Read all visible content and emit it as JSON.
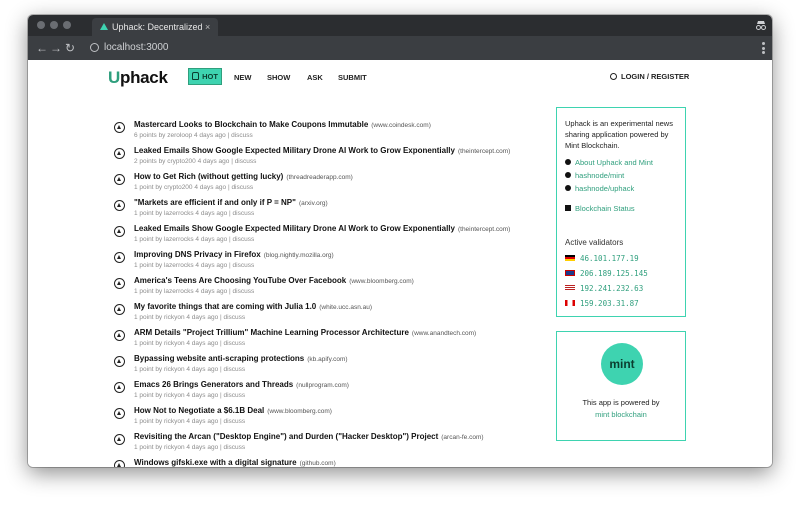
{
  "browser": {
    "tab_title": "Uphack: Decentralized Hac",
    "tab_close": "×",
    "url": "localhost:3000",
    "back": "←",
    "forward": "→",
    "reload": "↻"
  },
  "header": {
    "logo": "Uphack",
    "nav": [
      {
        "label": "HOT",
        "active": true
      },
      {
        "label": "NEW"
      },
      {
        "label": "SHOW"
      },
      {
        "label": "ASK"
      },
      {
        "label": "SUBMIT"
      }
    ],
    "login": "LOGIN / REGISTER"
  },
  "posts": [
    {
      "title": "Mastercard Looks to Blockchain to Make Coupons Immutable",
      "domain": "(www.coindesk.com)",
      "meta": "6 points  by zeroloop  4 days ago  |  discuss"
    },
    {
      "title": "Leaked Emails Show Google Expected Military Drone AI Work to Grow Exponentially",
      "domain": "(theintercept.com)",
      "meta": "2 points  by crypto200  4 days ago  |  discuss"
    },
    {
      "title": "How to Get Rich (without getting lucky)",
      "domain": "(threadreaderapp.com)",
      "meta": "1 point  by crypto200  4 days ago  |  discuss"
    },
    {
      "title": "\"Markets are efficient if and only if P = NP\"",
      "domain": "(arxiv.org)",
      "meta": "1 point  by lazerrocks  4 days ago  |  discuss"
    },
    {
      "title": "Leaked Emails Show Google Expected Military Drone AI Work to Grow Exponentially",
      "domain": "(theintercept.com)",
      "meta": "1 point  by lazerrocks  4 days ago  |  discuss"
    },
    {
      "title": "Improving DNS Privacy in Firefox",
      "domain": "(blog.nightly.mozilla.org)",
      "meta": "1 point  by lazerrocks  4 days ago  |  discuss"
    },
    {
      "title": "America's Teens Are Choosing YouTube Over Facebook",
      "domain": "(www.bloomberg.com)",
      "meta": "1 point  by lazerrocks  4 days ago  |  discuss"
    },
    {
      "title": "My favorite things that are coming with Julia 1.0",
      "domain": "(white.ucc.asn.au)",
      "meta": "1 point  by rickyon  4 days ago  |  discuss"
    },
    {
      "title": "ARM Details \"Project Trillium\" Machine Learning Processor Architecture",
      "domain": "(www.anandtech.com)",
      "meta": "1 point  by rickyon  4 days ago  |  discuss"
    },
    {
      "title": "Bypassing website anti-scraping protections",
      "domain": "(kb.apify.com)",
      "meta": "1 point  by rickyon  4 days ago  |  discuss"
    },
    {
      "title": "Emacs 26 Brings Generators and Threads",
      "domain": "(nullprogram.com)",
      "meta": "1 point  by rickyon  4 days ago  |  discuss"
    },
    {
      "title": "How Not to Negotiate a $6.1B Deal",
      "domain": "(www.bloomberg.com)",
      "meta": "1 point  by rickyon  4 days ago  |  discuss"
    },
    {
      "title": "Revisiting the Arcan (\"Desktop Engine\") and Durden (\"Hacker Desktop\") Project",
      "domain": "(arcan-fe.com)",
      "meta": "1 point  by rickyon  4 days ago  |  discuss"
    },
    {
      "title": "Windows gifski.exe with a digital signature",
      "domain": "(github.com)",
      "meta": ""
    }
  ],
  "sidebar": {
    "intro": "Uphack is an experimental news sharing application powered by Mint Blockchain.",
    "links": [
      {
        "label": "About Uphack and Mint",
        "icon": "bulb-icon"
      },
      {
        "label": "hashnode/mint",
        "icon": "github-icon"
      },
      {
        "label": "hashnode/uphack",
        "icon": "github-icon"
      }
    ],
    "status_link": "Blockchain Status",
    "validators_title": "Active validators",
    "validators": [
      {
        "ip": "46.101.177.19",
        "flag": "de"
      },
      {
        "ip": "206.189.125.145",
        "flag": "uk"
      },
      {
        "ip": "192.241.232.63",
        "flag": "us"
      },
      {
        "ip": "159.203.31.87",
        "flag": "ca"
      }
    ]
  },
  "powered": {
    "logo": "mint",
    "text": "This app is powered by",
    "link": "mint blockchain"
  },
  "colors": {
    "accent": "#3ed3b0",
    "accent_dark": "#2f9f7d",
    "chrome_dark": "#2b2d30"
  }
}
